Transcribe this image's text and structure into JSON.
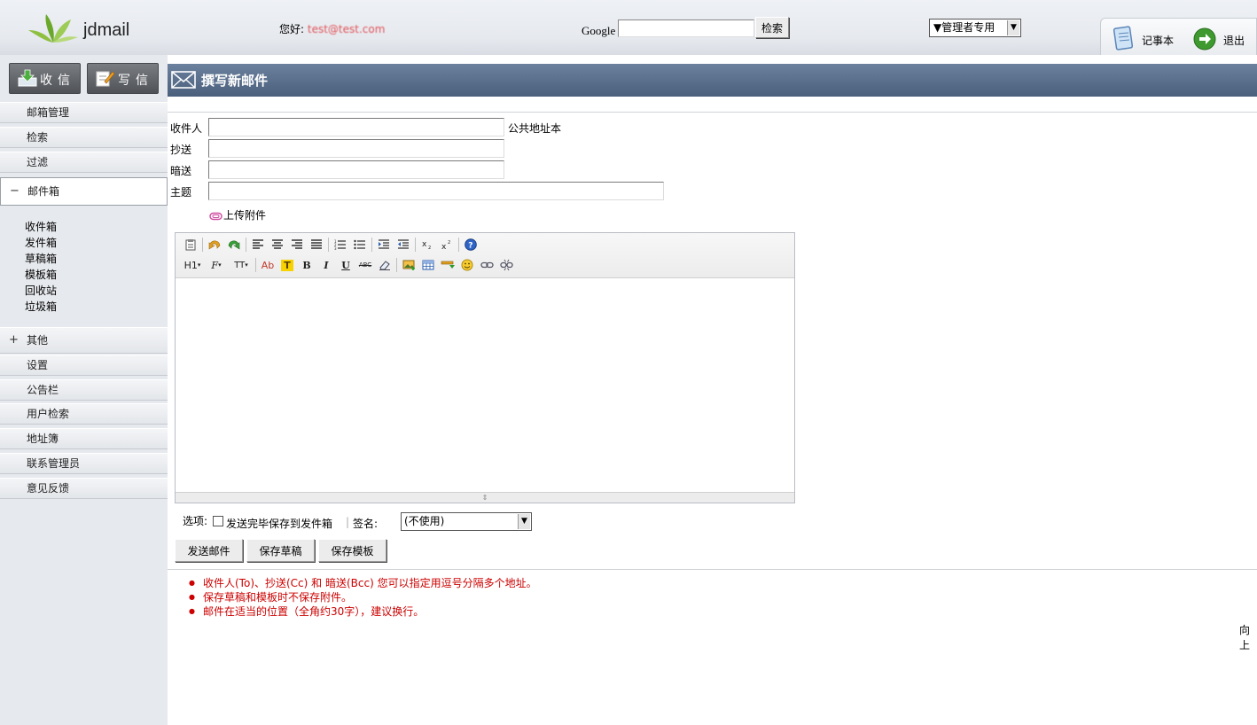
{
  "header": {
    "logo_text": "jdmail",
    "greeting": "您好:",
    "username": "test@test.com",
    "google_label": "Google",
    "search_value": "",
    "search_button": "检索",
    "admin_select": "▼管理者专用",
    "memo_label": "记事本",
    "logout_label": "退出"
  },
  "sidebar": {
    "receive_button": "收信",
    "write_button": "写信",
    "menu": [
      {
        "label": "邮箱管理"
      },
      {
        "label": "检索"
      },
      {
        "label": "过滤"
      }
    ],
    "mailbox": {
      "sign": "−",
      "label": "邮件箱",
      "folders": [
        "收件箱",
        "发件箱",
        "草稿箱",
        "模板箱",
        "回收站",
        "垃圾箱"
      ]
    },
    "other": {
      "sign": "+",
      "label": "其他",
      "items": [
        "设置",
        "公告栏",
        "用户检索",
        "地址簿",
        "联系管理员",
        "意见反馈"
      ]
    }
  },
  "main": {
    "title": "撰写新邮件",
    "fields": {
      "to_label": "收件人",
      "to_value": "",
      "address_book_link": "公共地址本",
      "cc_label": "抄送",
      "cc_value": "",
      "bcc_label": "暗送",
      "bcc_value": "",
      "subject_label": "主题",
      "subject_value": ""
    },
    "attach_label": "上传附件",
    "editor": {
      "heading_btn": "H1",
      "font_btn": "F",
      "size_btn": "TT",
      "color_btn": "Ab",
      "highlight_btn": "T",
      "bold_btn": "B",
      "italic_btn": "I",
      "underline_btn": "U",
      "strike_btn": "ABC",
      "content": ""
    },
    "options": {
      "label": "选项:",
      "save_to_sent": "发送完毕保存到发件箱",
      "separator": "|",
      "signature_label": "签名:",
      "signature_value": "(不使用)"
    },
    "buttons": {
      "send": "发送邮件",
      "save_draft": "保存草稿",
      "save_template": "保存模板"
    },
    "notes": [
      "收件人(To)、抄送(Cc) 和  暗送(Bcc) 您可以指定用逗号分隔多个地址。",
      "保存草稿和模板时不保存附件。",
      "邮件在适当的位置（全角约30字），建议换行。"
    ],
    "to_top": "向上"
  },
  "colors": {
    "title_bar": "#5a6f8c",
    "notes_red": "#cc0000",
    "sidebar_bg": "#e6e9ed"
  }
}
